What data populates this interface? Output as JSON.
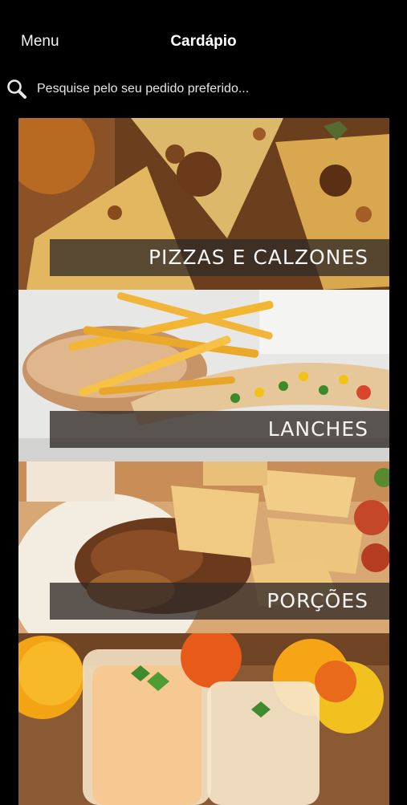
{
  "header": {
    "menu_label": "Menu",
    "title": "Cardápio"
  },
  "search": {
    "placeholder": "Pesquise pelo seu pedido preferido...",
    "icon": "search-icon"
  },
  "categories": [
    {
      "label": "PIZZAS E CALZONES"
    },
    {
      "label": "LANCHES"
    },
    {
      "label": "PORÇÕES"
    },
    {
      "label": ""
    }
  ],
  "colors": {
    "background": "#000000",
    "band": "#322a26"
  }
}
